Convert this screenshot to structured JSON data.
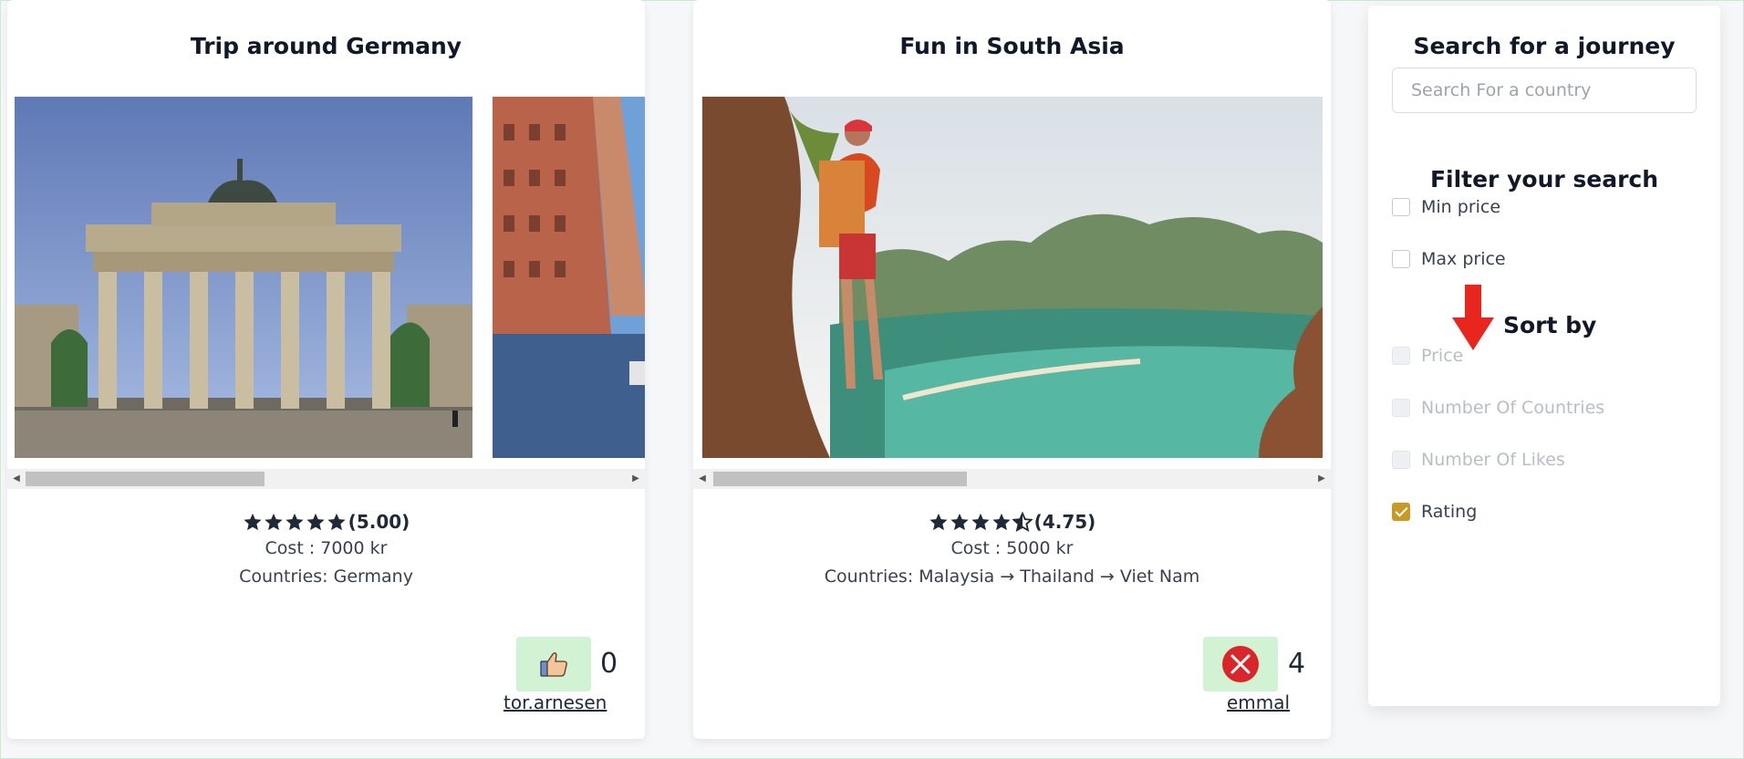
{
  "journeys": [
    {
      "title": "Trip around Germany",
      "rating": 5.0,
      "rating_text": "(5.00)",
      "cost_text": "Cost : 7000 kr",
      "countries_text": "Countries: Germany",
      "like_icon": "thumbs-up-icon",
      "likes": "0",
      "author": "tor.arnesen",
      "gallery_images": [
        "brandenburg-gate-photo",
        "speicherstadt-canal-photo"
      ]
    },
    {
      "title": "Fun in South Asia",
      "rating": 4.75,
      "rating_text": "(4.75)",
      "cost_text": "Cost : 5000 kr",
      "countries_text": "Countries: Malaysia → Thailand → Viet Nam",
      "like_icon": "red-x-circle-icon",
      "likes": "4",
      "author": "emmal",
      "gallery_images": [
        "hiker-over-bay-photo"
      ]
    }
  ],
  "sidebar": {
    "search_heading": "Search for a journey",
    "search_placeholder": "Search For a country",
    "filter_heading": "Filter your search",
    "filters": [
      {
        "label": "Min price",
        "checked": false,
        "disabled": false
      },
      {
        "label": "Max price",
        "checked": false,
        "disabled": false
      }
    ],
    "sort_heading": "Sort by",
    "sort_options": [
      {
        "label": "Price",
        "checked": false,
        "disabled": true
      },
      {
        "label": "Number Of Countries",
        "checked": false,
        "disabled": true
      },
      {
        "label": "Number Of Likes",
        "checked": false,
        "disabled": true
      },
      {
        "label": "Rating",
        "checked": true,
        "disabled": false
      }
    ]
  },
  "colors": {
    "like_box": "#d1f2d3",
    "checkbox_checked": "#c79a26",
    "annotation_arrow": "#e8261d",
    "star": "#1f2937"
  }
}
